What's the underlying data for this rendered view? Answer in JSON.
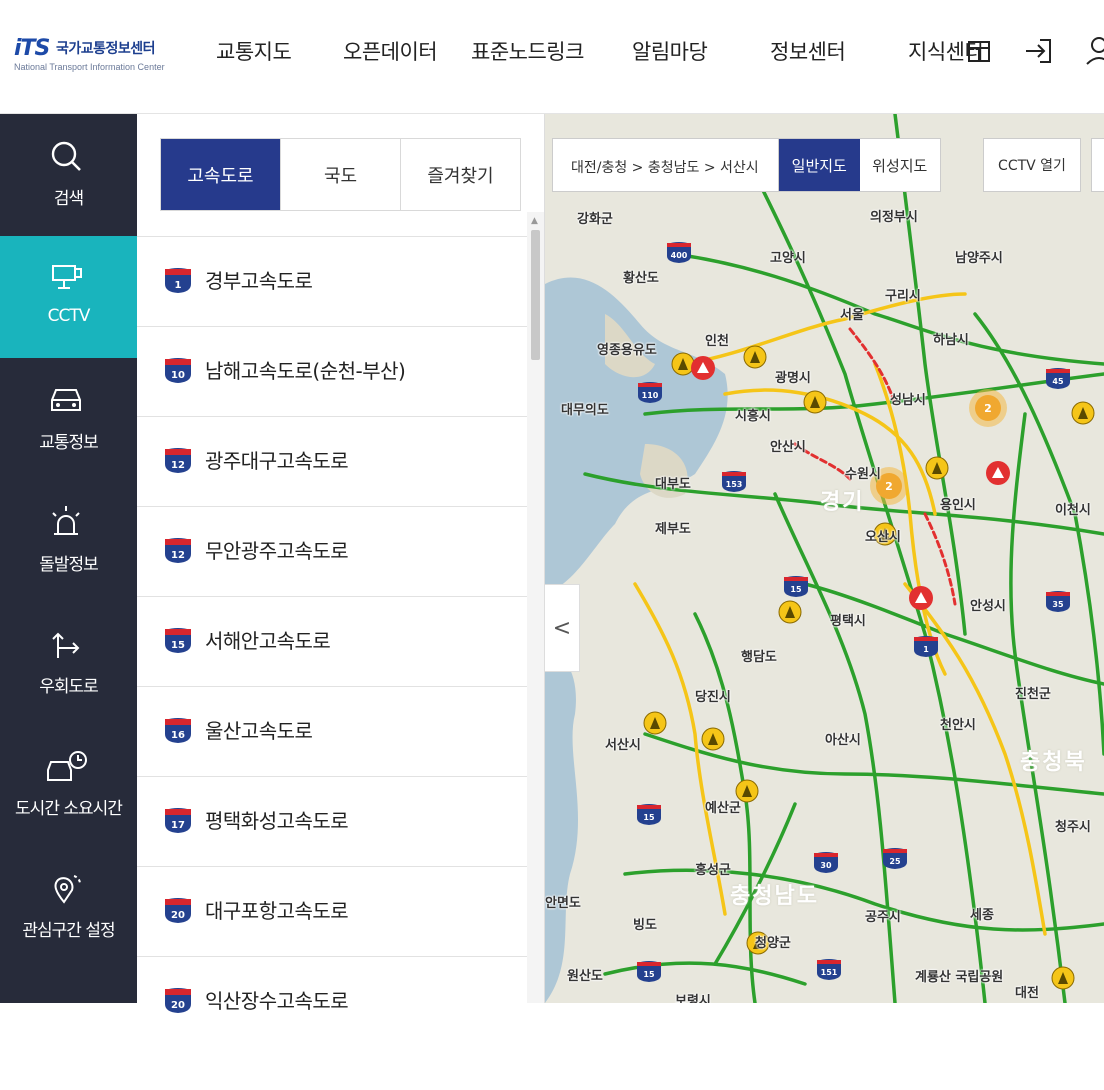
{
  "header": {
    "logo_mark": "iTS",
    "logo_korean": "국가교통정보센터",
    "logo_english": "National Transport Information Center",
    "nav": [
      "교통지도",
      "오픈데이터",
      "표준노드링크",
      "알림마당",
      "정보센터",
      "지식센터"
    ]
  },
  "sidebar": {
    "items": [
      {
        "label": "검색",
        "icon": "search-icon"
      },
      {
        "label": "CCTV",
        "icon": "cctv-icon"
      },
      {
        "label": "교통정보",
        "icon": "car-icon"
      },
      {
        "label": "돌발정보",
        "icon": "alert-light-icon"
      },
      {
        "label": "우회도로",
        "icon": "detour-arrow-icon"
      },
      {
        "label": "도시간 소요시간",
        "icon": "car-clock-icon"
      },
      {
        "label": "관심구간 설정",
        "icon": "location-pin-icon"
      }
    ]
  },
  "panel": {
    "tabs": [
      "고속도로",
      "국도",
      "즐겨찾기"
    ],
    "roads": [
      {
        "num": "1",
        "name": "경부고속도로"
      },
      {
        "num": "10",
        "name": "남해고속도로(순천-부산)"
      },
      {
        "num": "12",
        "name": "광주대구고속도로"
      },
      {
        "num": "12",
        "name": "무안광주고속도로"
      },
      {
        "num": "15",
        "name": "서해안고속도로"
      },
      {
        "num": "16",
        "name": "울산고속도로"
      },
      {
        "num": "17",
        "name": "평택화성고속도로"
      },
      {
        "num": "20",
        "name": "대구포항고속도로"
      },
      {
        "num": "20",
        "name": "익산장수고속도로"
      }
    ]
  },
  "map": {
    "breadcrumb": "대전/충청  >  충청남도  >  서산시",
    "maptype_normal": "일반지도",
    "maptype_satellite": "위성지도",
    "cctv_open": "CCTV 열기",
    "collapse_arrow": "<",
    "cluster_counts": [
      "2",
      "2"
    ],
    "places": [
      {
        "name": "의정부시"
      },
      {
        "name": "고양시"
      },
      {
        "name": "남양주시"
      },
      {
        "name": "강화군"
      },
      {
        "name": "황산도"
      },
      {
        "name": "구리시"
      },
      {
        "name": "서울"
      },
      {
        "name": "인천"
      },
      {
        "name": "하남시"
      },
      {
        "name": "영종용유도"
      },
      {
        "name": "광명시"
      },
      {
        "name": "대무의도"
      },
      {
        "name": "시흥시"
      },
      {
        "name": "성남시"
      },
      {
        "name": "안산시"
      },
      {
        "name": "수원시"
      },
      {
        "name": "대부도"
      },
      {
        "name": "용인시"
      },
      {
        "name": "이천시"
      },
      {
        "name": "제부도"
      },
      {
        "name": "경기"
      },
      {
        "name": "오산시"
      },
      {
        "name": "평택시"
      },
      {
        "name": "안성시"
      },
      {
        "name": "행담도"
      },
      {
        "name": "당진시"
      },
      {
        "name": "진천군"
      },
      {
        "name": "천안시"
      },
      {
        "name": "서산시"
      },
      {
        "name": "아산시"
      },
      {
        "name": "예산군"
      },
      {
        "name": "충청북"
      },
      {
        "name": "청주시"
      },
      {
        "name": "홍성군"
      },
      {
        "name": "충청남도"
      },
      {
        "name": "안면도"
      },
      {
        "name": "공주시"
      },
      {
        "name": "세종"
      },
      {
        "name": "빙도"
      },
      {
        "name": "청양군"
      },
      {
        "name": "원산도"
      },
      {
        "name": "계룡산 국립공원"
      },
      {
        "name": "대전"
      },
      {
        "name": "보령시"
      }
    ],
    "route_shields": [
      "400",
      "110",
      "153",
      "15",
      "45",
      "35",
      "1",
      "15",
      "30",
      "25",
      "151",
      "15"
    ]
  },
  "colors": {
    "accent_navy": "#263a8c",
    "accent_teal": "#19b4bd",
    "sidebar_bg": "#272b3a",
    "traffic_green": "#2ca02c",
    "traffic_yellow": "#f5c518",
    "traffic_red": "#e23030"
  }
}
